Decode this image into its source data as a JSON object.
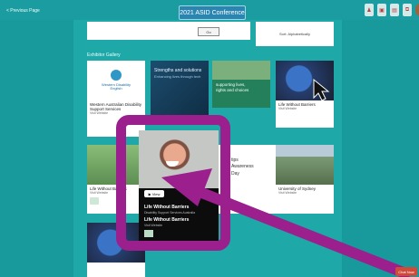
{
  "header": {
    "back_label": "< Previous Page",
    "title": "2021 ASID Conference"
  },
  "search": {
    "placeholder": "",
    "button_label": "Go"
  },
  "sort": {
    "label": "Sort: Alphabetically"
  },
  "gallery": {
    "section_label": "Exhibitor Gallery",
    "cards": [
      {
        "title": "Western Australian Disability Support Services",
        "sub": "Visit Website",
        "logo_text": "Western Disability English"
      },
      {
        "title": "",
        "sub": "",
        "thumb_heading": "Strengths and solutions",
        "thumb_sub": "Enhancing lives through tech"
      },
      {
        "title": "",
        "sub": "",
        "thumb_heading": "supporting lives,",
        "thumb_sub": "rights and choices"
      },
      {
        "title": "Life Without Barriers",
        "sub": "Visit Website"
      },
      {
        "title": "Life Without Barriers",
        "sub": "Visit Website"
      },
      {
        "title": "",
        "sub": ""
      },
      {
        "title": "",
        "sub": ""
      },
      {
        "title": "University of Sydney",
        "sub": "Visit Website"
      },
      {
        "title": "",
        "sub": ""
      }
    ],
    "middle_card_lines": [
      "tips",
      "Awareness",
      "Day"
    ]
  },
  "hero": {
    "play_label": "View",
    "title": "Life Without Barriers",
    "sub": "Disability Support Services Australia",
    "title2": "Life Without Barriers",
    "sub2": "Visit Website"
  },
  "chat": {
    "label": "Chat Now"
  },
  "colors": {
    "background": "#1aa7a4",
    "highlight_frame": "#9b1f8c",
    "title_pill": "#2a86b0"
  }
}
